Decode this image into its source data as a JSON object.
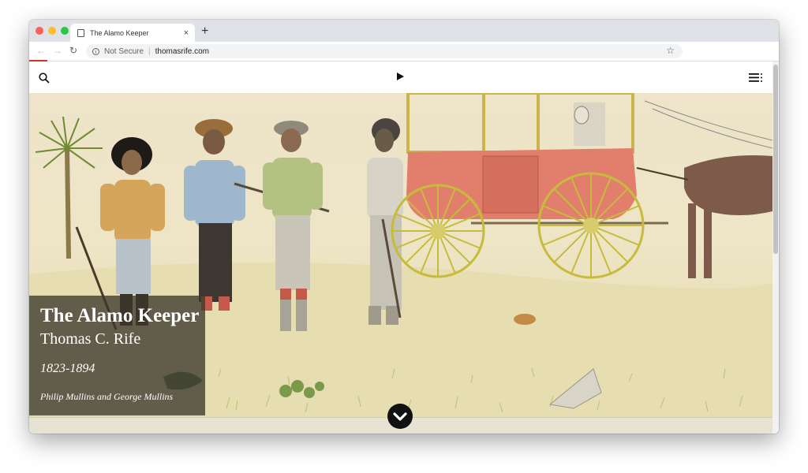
{
  "browser": {
    "tab_title": "The Alamo Keeper",
    "tab_close": "×",
    "new_tab": "+",
    "security_label": "Not Secure",
    "url": "thomasrife.com",
    "star": "☆",
    "back": "←",
    "forward": "→",
    "reload": "↻",
    "traffic_colors": [
      "#ff5f57",
      "#febc2e",
      "#28c840"
    ]
  },
  "site": {
    "nav_icons": [
      "search-icon",
      "play-icon",
      "menu-icon"
    ]
  },
  "hero": {
    "title": "The Alamo Keeper",
    "subtitle": "Thomas C. Rife",
    "dates": "1823-1894",
    "authors": "Philip Mullins and George Mullins"
  }
}
